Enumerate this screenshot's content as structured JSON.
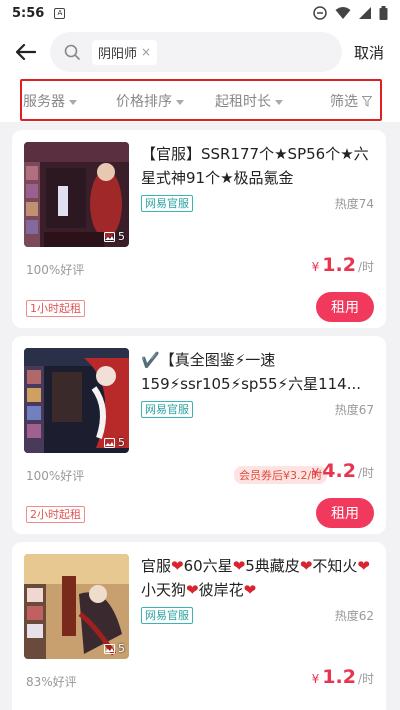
{
  "status_bar": {
    "time": "5:56",
    "notif_glyph": "A"
  },
  "header": {
    "search_chip": "阴阳师",
    "chip_close": "×",
    "cancel_label": "取消"
  },
  "filters": [
    {
      "label": "服务器"
    },
    {
      "label": "价格排序"
    },
    {
      "label": "起租时长"
    },
    {
      "label": "筛选"
    }
  ],
  "listings": [
    {
      "image_count": "5",
      "title": "【官服】SSR177个★SP56个★六星式神91个★极品氪金",
      "badge": "网易官服",
      "heat": "热度74",
      "rating": "100%好评",
      "price_currency": "¥",
      "price_value": "1.2",
      "price_unit": "/时",
      "min_rent": "1小时起租",
      "rent_label": "租用"
    },
    {
      "image_count": "5",
      "title_prefix": "✔️",
      "title": "【真全图鉴⚡一速159⚡ssr105⚡sp55⚡六星114...",
      "badge": "网易官服",
      "heat": "热度67",
      "rating": "100%好评",
      "coupon": "会员券后¥3.2/时",
      "price_currency": "¥",
      "price_value": "4.2",
      "price_unit": "/时",
      "min_rent": "2小时起租",
      "rent_label": "租用"
    },
    {
      "image_count": "5",
      "title_parts": [
        "官服",
        "60六星",
        "5典藏皮",
        "不知火",
        "小天狗",
        "彼岸花"
      ],
      "badge": "网易官服",
      "heat": "热度62",
      "rating": "83%好评",
      "price_currency": "¥",
      "price_value": "1.2",
      "price_unit": "/时"
    }
  ]
}
